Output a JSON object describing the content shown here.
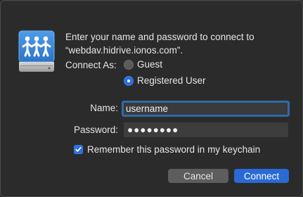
{
  "message": {
    "line1": "Enter your name and password to connect to",
    "line2": "“webdav.hidrive.ionos.com”."
  },
  "connect_as": {
    "label": "Connect As:",
    "options": [
      {
        "label": "Guest",
        "selected": false
      },
      {
        "label": "Registered User",
        "selected": true
      }
    ]
  },
  "fields": {
    "name_label": "Name:",
    "name_value": "username",
    "password_label": "Password:",
    "password_value": "●●●●●●●●"
  },
  "remember": {
    "label": "Remember this password in my keychain",
    "checked": true
  },
  "buttons": {
    "cancel": "Cancel",
    "connect": "Connect"
  },
  "icons": {
    "server": "shared-server-icon"
  },
  "colors": {
    "accent": "#2a6ad6",
    "focus_ring": "#2f6aa8",
    "background": "#2b2b2b"
  }
}
